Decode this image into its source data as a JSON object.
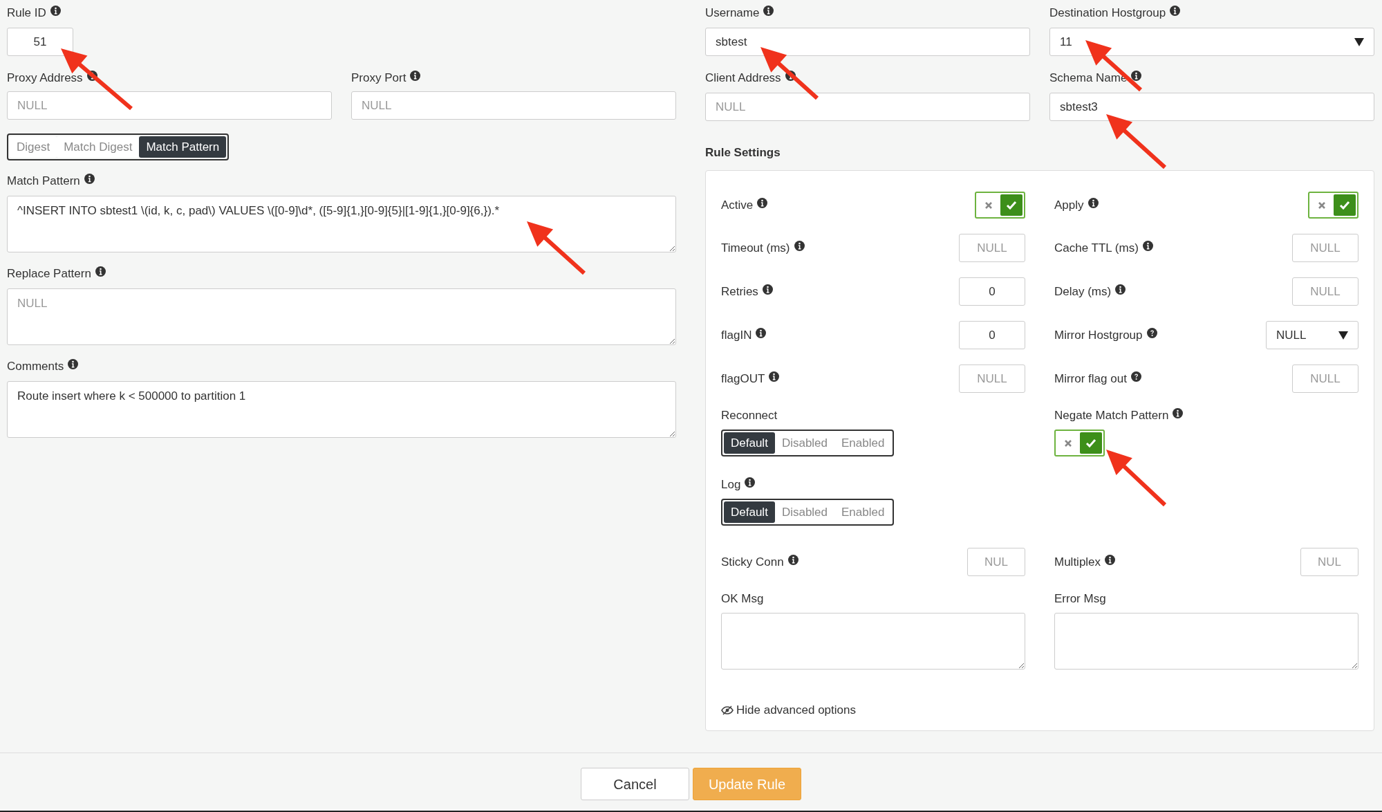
{
  "rule_id": {
    "label": "Rule ID",
    "hint": {
      "kind": "info"
    },
    "value": "51"
  },
  "username": {
    "label": "Username",
    "hint": {
      "kind": "info"
    },
    "value": "sbtest"
  },
  "destination_hostgroup": {
    "label": "Destination Hostgroup",
    "hint": {
      "kind": "info"
    },
    "value": "11"
  },
  "proxy_address": {
    "label": "Proxy Address",
    "hint": {
      "kind": "info"
    },
    "placeholder": "NULL"
  },
  "proxy_port": {
    "label": "Proxy Port",
    "hint": {
      "kind": "info"
    },
    "placeholder": "NULL"
  },
  "client_address": {
    "label": "Client Address",
    "hint": {
      "kind": "info"
    },
    "placeholder": "NULL"
  },
  "schema_name": {
    "label": "Schema Name",
    "hint": {
      "kind": "info"
    },
    "value": "sbtest3"
  },
  "match_mode": [
    {
      "label": "Digest",
      "selected": false
    },
    {
      "label": "Match Digest",
      "selected": false
    },
    {
      "label": "Match Pattern",
      "selected": true
    }
  ],
  "text_areas": [
    {
      "label": "Match Pattern",
      "hint": {
        "kind": "info"
      },
      "value": "^INSERT INTO sbtest1 \\(id, k, c, pad\\) VALUES \\([0-9]\\d*, ([5-9]{1,}[0-9]{5}|[1-9]{1,}[0-9]{6,}).*"
    },
    {
      "label": "Replace Pattern",
      "hint": {
        "kind": "info"
      },
      "placeholder": "NULL"
    },
    {
      "label": "Comments",
      "hint": {
        "kind": "info"
      },
      "value": "Route insert where k < 500000 to partition 1"
    }
  ],
  "rule_settings": {
    "title": "Rule Settings",
    "rows": [
      {
        "left": {
          "kind": "toggle",
          "label": "Active",
          "hint": {
            "kind": "info"
          },
          "checked": true
        },
        "right": {
          "kind": "toggle",
          "label": "Apply",
          "hint": {
            "kind": "info"
          },
          "checked": true
        }
      },
      {
        "left": {
          "kind": "input",
          "label": "Timeout (ms)",
          "hint": {
            "kind": "info"
          },
          "placeholder": "NULL"
        },
        "right": {
          "kind": "input",
          "label": "Cache TTL (ms)",
          "hint": {
            "kind": "info"
          },
          "placeholder": "NULL"
        }
      },
      {
        "left": {
          "kind": "input",
          "label": "Retries",
          "hint": {
            "kind": "info"
          },
          "value": "0"
        },
        "right": {
          "kind": "input",
          "label": "Delay (ms)",
          "hint": {
            "kind": "info"
          },
          "placeholder": "NULL"
        }
      },
      {
        "left": {
          "kind": "input",
          "label": "flagIN",
          "hint": {
            "kind": "info"
          },
          "value": "0"
        },
        "right": {
          "kind": "select",
          "label": "Mirror Hostgroup",
          "hint": {
            "kind": "help"
          },
          "value": "NULL"
        }
      },
      {
        "left": {
          "kind": "input",
          "label": "flagOUT",
          "hint": {
            "kind": "info"
          },
          "placeholder": "NULL"
        },
        "right": {
          "kind": "input",
          "label": "Mirror flag out",
          "hint": {
            "kind": "help"
          },
          "placeholder": "NULL"
        }
      },
      {
        "left": {
          "kind": "segmented",
          "label": "Reconnect",
          "options": [
            {
              "label": "Default",
              "selected": true
            },
            {
              "label": "Disabled",
              "selected": false
            },
            {
              "label": "Enabled",
              "selected": false
            }
          ]
        },
        "right": {
          "kind": "stacked_toggle",
          "label": "Negate Match Pattern",
          "hint": {
            "kind": "info"
          },
          "checked": true
        }
      },
      {
        "left": {
          "kind": "segmented",
          "label": "Log",
          "hint": {
            "kind": "info"
          },
          "options": [
            {
              "label": "Default",
              "selected": true
            },
            {
              "label": "Disabled",
              "selected": false
            },
            {
              "label": "Enabled",
              "selected": false
            }
          ]
        }
      },
      {
        "left": {
          "kind": "short_input",
          "label": "Sticky Conn",
          "hint": {
            "kind": "info"
          },
          "placeholder": "NUL"
        },
        "right": {
          "kind": "short_input",
          "label": "Multiplex",
          "hint": {
            "kind": "info"
          },
          "placeholder": "NUL"
        }
      },
      {
        "left": {
          "kind": "textarea",
          "label": "OK Msg"
        },
        "right": {
          "kind": "textarea",
          "label": "Error Msg"
        }
      }
    ],
    "toggle_advanced": "Hide advanced options"
  },
  "buttons": [
    {
      "label": "Cancel",
      "kind": "default"
    },
    {
      "label": "Update Rule",
      "kind": "primary"
    }
  ]
}
